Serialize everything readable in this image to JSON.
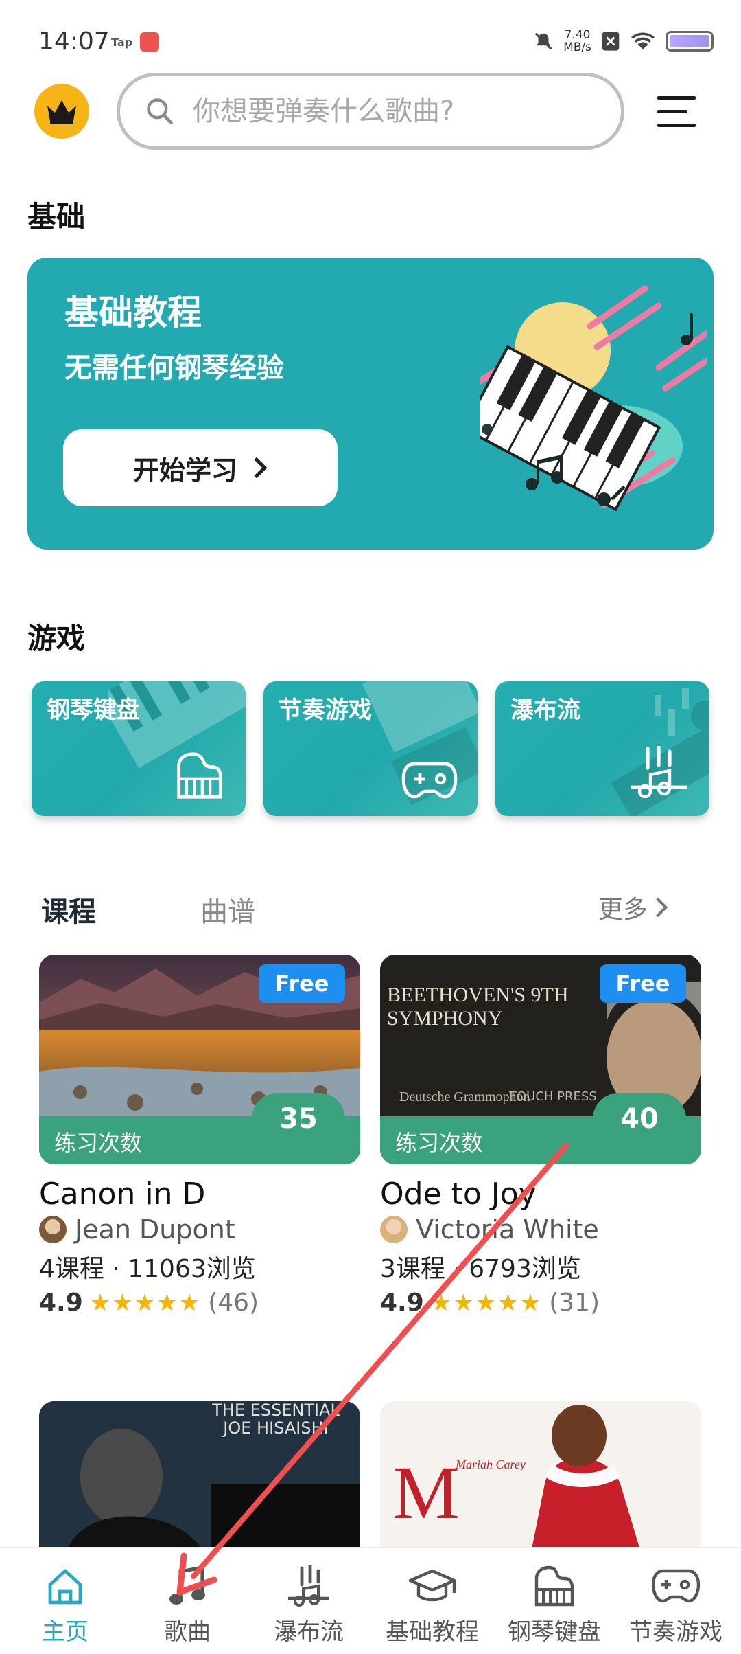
{
  "status_bar": {
    "time": "14:07",
    "tap": "Tap",
    "speed_value": "7.40",
    "speed_unit": "MB/s"
  },
  "search": {
    "placeholder": "你想要弹奏什么歌曲?"
  },
  "sections": {
    "basic": "基础",
    "games": "游戏"
  },
  "basic_card": {
    "title": "基础教程",
    "subtitle": "无需任何钢琴经验",
    "button": "开始学习"
  },
  "games": [
    {
      "label": "钢琴键盘",
      "icon": "piano-icon"
    },
    {
      "label": "节奏游戏",
      "icon": "gamepad-icon"
    },
    {
      "label": "瀑布流",
      "icon": "waterfall-music-icon"
    }
  ],
  "tabs": {
    "course": "课程",
    "score": "曲谱",
    "more": "更多"
  },
  "courses": [
    {
      "free": "Free",
      "practice_label": "练习次数",
      "practice_count": "35",
      "title": "Canon in D",
      "author": "Jean Dupont",
      "stats": "4课程 · 11063浏览",
      "rating": "4.9",
      "rating_count": "(46)",
      "stars": 5
    },
    {
      "free": "Free",
      "practice_label": "练习次数",
      "practice_count": "40",
      "title": "Ode to Joy",
      "author": "Victoria White",
      "stats": "3课程 · 6793浏览",
      "rating": "4.9",
      "rating_count": "(31)",
      "stars": 5,
      "cover_text_1": "BEETHOVEN'S 9TH SYMPHONY",
      "cover_text_2": "Deutsche Grammophon",
      "cover_text_3": "TOUCH PRESS"
    }
  ],
  "more_covers": [
    {
      "text": "THE ESSENTIAL JOE HISAISHI"
    },
    {
      "text": "Mariah Carey"
    }
  ],
  "bottom_nav": [
    {
      "label": "主页",
      "icon": "home-icon",
      "active": true
    },
    {
      "label": "歌曲",
      "icon": "music-note-icon",
      "active": false
    },
    {
      "label": "瀑布流",
      "icon": "waterfall-icon",
      "active": false
    },
    {
      "label": "基础教程",
      "icon": "graduation-cap-icon",
      "active": false
    },
    {
      "label": "钢琴键盘",
      "icon": "piano-icon",
      "active": false
    },
    {
      "label": "节奏游戏",
      "icon": "gamepad-icon",
      "active": false
    }
  ],
  "colors": {
    "teal": "#22aab0",
    "green": "#3aa27c",
    "blue": "#1e8ef0",
    "active": "#29a8c2",
    "annotation_arrow": "#ef4f4f"
  }
}
